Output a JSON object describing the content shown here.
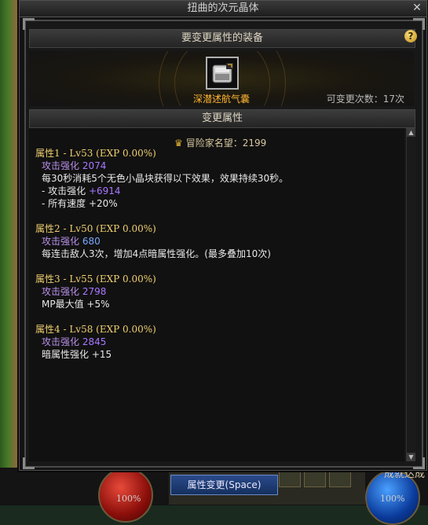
{
  "window": {
    "title": "扭曲的次元晶体",
    "close_glyph": "✕"
  },
  "equip_section": {
    "header": "要变更属性的装备",
    "help_glyph": "?",
    "item_name": "深潜述航气囊",
    "change_count": "可变更次数：17次"
  },
  "attr_section": {
    "header": "变更属性",
    "fame_label": "冒险家名望：2199",
    "attributes": [
      {
        "head": "属性1 - Lv53 (EXP 0.00%)",
        "stat_label": "攻击强化",
        "stat_value": "2074",
        "lines": [
          "每30秒消耗5个无色小晶块获得以下效果，效果持续30秒。",
          "- 攻击强化 ",
          "- 所有速度 +20%"
        ],
        "line1_value": "+6914"
      },
      {
        "head": "属性2 - Lv50 (EXP 0.00%)",
        "stat_label": "攻击强化",
        "stat_value": "680",
        "lines": [
          "每连击敌人3次，增加4点暗属性强化。(最多叠加10次)"
        ]
      },
      {
        "head": "属性3 - Lv55 (EXP 0.00%)",
        "stat_label": "攻击强化",
        "stat_value": "2798",
        "lines": [
          "MP最大值 +5%"
        ]
      },
      {
        "head": "属性4 - Lv58 (EXP 0.00%)",
        "stat_label": "攻击强化",
        "stat_value": "2845",
        "lines": [
          "暗属性强化 +15"
        ]
      }
    ]
  },
  "footer": {
    "confirm_button": "属性变更(Space)",
    "hp_percent": "100%",
    "mp_percent": "100%",
    "achievement_text": "成就达成"
  },
  "colors": {
    "accent_gold": "#f0d070",
    "item_orange": "#ffb530",
    "stat_purple": "#a878ff"
  },
  "icons": {
    "fame": "fame-medal-icon",
    "close": "close-icon",
    "help": "help-icon"
  }
}
